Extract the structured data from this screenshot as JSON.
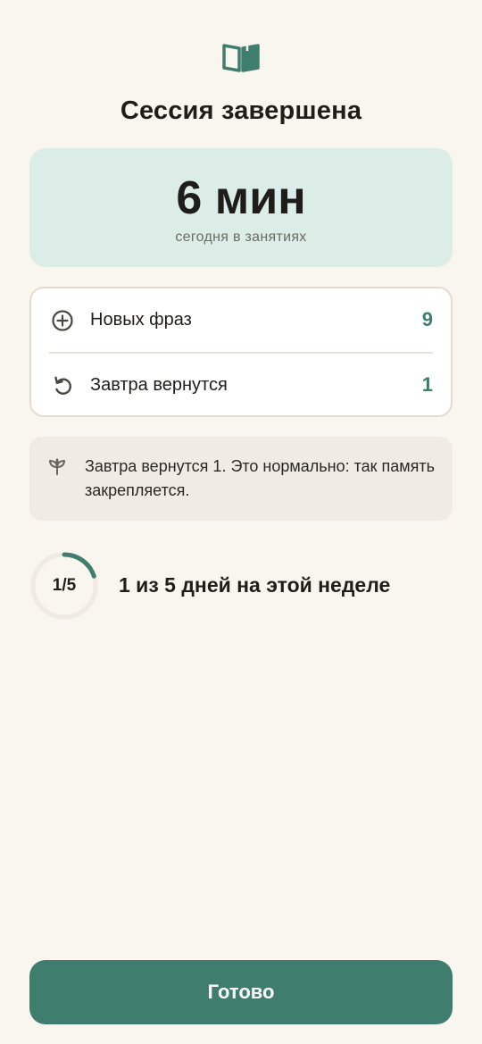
{
  "header": {
    "title": "Сессия завершена"
  },
  "time_card": {
    "value": "6 мин",
    "caption": "сегодня в занятиях"
  },
  "stats": [
    {
      "label": "Новых фраз",
      "value": "9",
      "icon": "plus-circle-icon"
    },
    {
      "label": "Завтра вернутся",
      "value": "1",
      "icon": "refresh-icon"
    }
  ],
  "note": {
    "icon": "sprout-icon",
    "text": "Завтра вернутся 1. Это нормально: так память закрепляется."
  },
  "progress": {
    "label": "1/5",
    "done": 1,
    "total": 5,
    "text": "1 из 5 дней на этой неделе"
  },
  "footer": {
    "button_label": "Готово"
  },
  "colors": {
    "accent": "#3f7d6e",
    "background": "#f9f6ef",
    "time_card_bg": "#dcece6",
    "note_bg": "#f0ece4",
    "track": "#efebe3"
  }
}
